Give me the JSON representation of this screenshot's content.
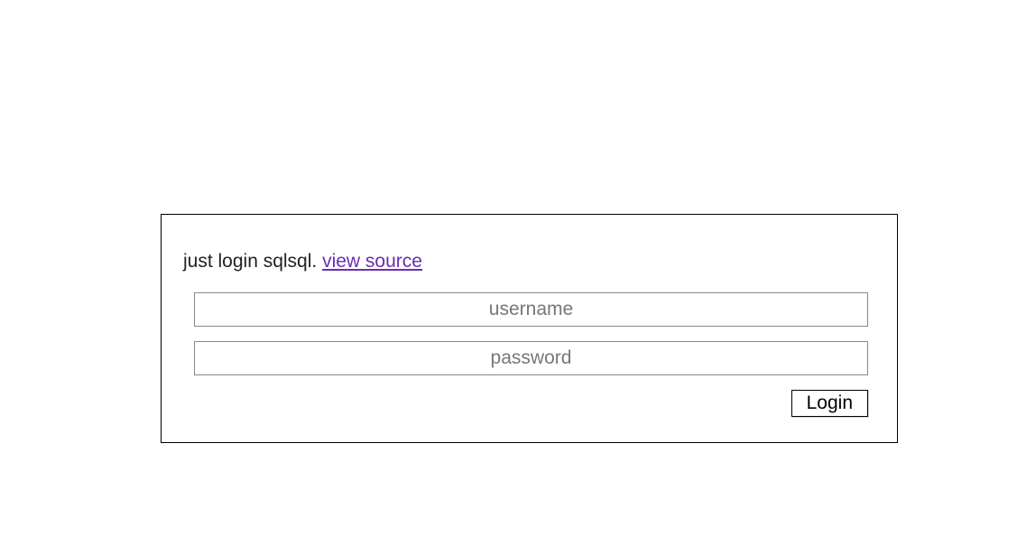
{
  "intro": {
    "text_before_link": "just login sqlsql. ",
    "link_text": "view source"
  },
  "fields": {
    "username": {
      "placeholder": "username",
      "value": ""
    },
    "password": {
      "placeholder": "password",
      "value": ""
    }
  },
  "buttons": {
    "login_label": "Login"
  },
  "colors": {
    "link": "#6a2db3",
    "border": "#000000",
    "placeholder": "#777777"
  }
}
